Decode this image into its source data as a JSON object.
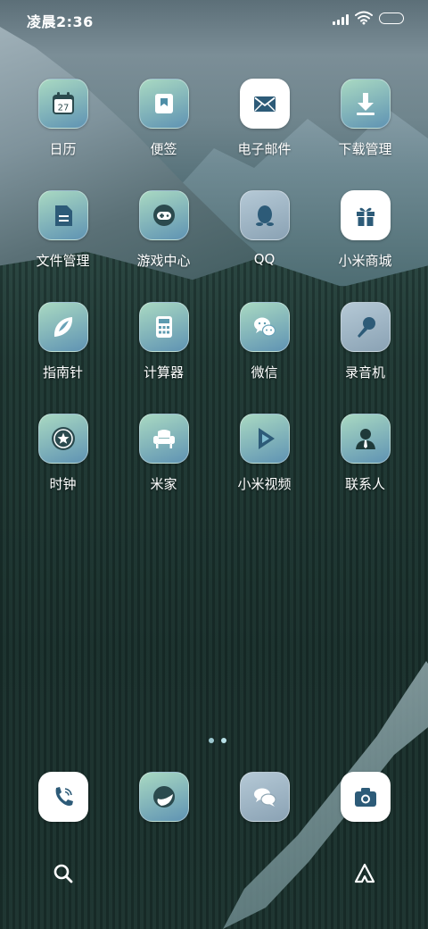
{
  "status_bar": {
    "time": "凌晨2:36"
  },
  "apps": [
    {
      "label": "日历",
      "icon": "calendar-icon",
      "day": "27"
    },
    {
      "label": "便签",
      "icon": "notes-icon"
    },
    {
      "label": "电子邮件",
      "icon": "mail-icon"
    },
    {
      "label": "下载管理",
      "icon": "download-icon"
    },
    {
      "label": "文件管理",
      "icon": "file-manager-icon"
    },
    {
      "label": "游戏中心",
      "icon": "gamepad-icon"
    },
    {
      "label": "QQ",
      "icon": "qq-penguin-icon"
    },
    {
      "label": "小米商城",
      "icon": "gift-box-icon"
    },
    {
      "label": "指南针",
      "icon": "compass-icon"
    },
    {
      "label": "计算器",
      "icon": "calculator-icon"
    },
    {
      "label": "微信",
      "icon": "wechat-icon"
    },
    {
      "label": "录音机",
      "icon": "microphone-icon"
    },
    {
      "label": "时钟",
      "icon": "clock-star-icon"
    },
    {
      "label": "米家",
      "icon": "armchair-icon"
    },
    {
      "label": "小米视频",
      "icon": "video-play-icon"
    },
    {
      "label": "联系人",
      "icon": "contact-person-icon"
    }
  ],
  "dock": [
    {
      "name": "phone",
      "icon": "phone-icon"
    },
    {
      "name": "browser",
      "icon": "browser-globe-icon"
    },
    {
      "name": "messages",
      "icon": "chat-bubbles-icon"
    },
    {
      "name": "camera",
      "icon": "camera-icon"
    }
  ],
  "page_indicator": {
    "pages": 2,
    "current": 2
  },
  "bottom_bar": {
    "left_icon": "search-icon",
    "right_icon": "assistant-icon"
  },
  "colors": {
    "icon_gradient_top": "#a9d9c2",
    "icon_gradient_bottom": "#5f93b3",
    "icon_white": "#ffffff",
    "glyph_dark": "#2d5b78",
    "glyph_light": "#ffffff"
  }
}
